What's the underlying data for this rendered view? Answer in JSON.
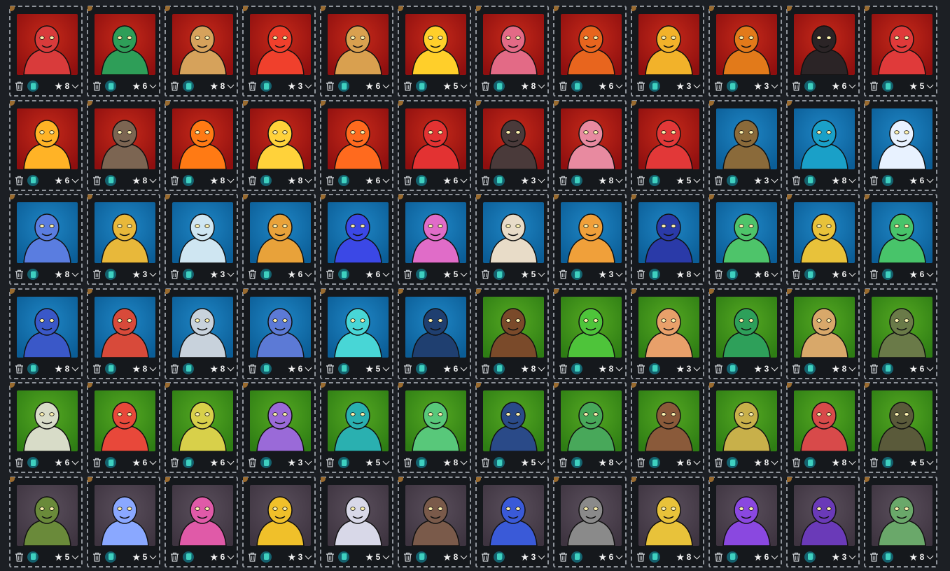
{
  "element_colors": {
    "fire": {
      "bg": "#8e0f0f",
      "glow": "#c72a1a"
    },
    "water": {
      "bg": "#0b5d96",
      "glow": "#1f86c5"
    },
    "earth": {
      "bg": "#2e7d14",
      "glow": "#55a822"
    },
    "death": {
      "bg": "#3e3440",
      "glow": "#5a4f5c"
    }
  },
  "icons": {
    "remove": "trash-icon",
    "deck": "card-deck-icon",
    "level": "star-icon",
    "dropdown": "chevron-down-icon"
  },
  "cards": [
    {
      "element": "fire",
      "accent": "#d93b3b",
      "level": "8"
    },
    {
      "element": "fire",
      "accent": "#2e9e58",
      "level": "6"
    },
    {
      "element": "fire",
      "accent": "#d6a25b",
      "level": "8"
    },
    {
      "element": "fire",
      "accent": "#f0402c",
      "level": "3"
    },
    {
      "element": "fire",
      "accent": "#d9a04f",
      "level": "6"
    },
    {
      "element": "fire",
      "accent": "#ffcf2a",
      "level": "5"
    },
    {
      "element": "fire",
      "accent": "#e36a86",
      "level": "8"
    },
    {
      "element": "fire",
      "accent": "#e8651e",
      "level": "6"
    },
    {
      "element": "fire",
      "accent": "#f2b22a",
      "level": "3"
    },
    {
      "element": "fire",
      "accent": "#e27a1a",
      "level": "3"
    },
    {
      "element": "fire",
      "accent": "#2b2426",
      "level": "6"
    },
    {
      "element": "fire",
      "accent": "#e03a3a",
      "level": "5"
    },
    {
      "element": "fire",
      "accent": "#ffb326",
      "level": "6"
    },
    {
      "element": "fire",
      "accent": "#7c6552",
      "level": "8"
    },
    {
      "element": "fire",
      "accent": "#ff7a14",
      "level": "8"
    },
    {
      "element": "fire",
      "accent": "#ffd23a",
      "level": "8"
    },
    {
      "element": "fire",
      "accent": "#ff6a1e",
      "level": "6"
    },
    {
      "element": "fire",
      "accent": "#e33232",
      "level": "6"
    },
    {
      "element": "fire",
      "accent": "#4a3a3a",
      "level": "3"
    },
    {
      "element": "fire",
      "accent": "#e88aa0",
      "level": "8"
    },
    {
      "element": "fire",
      "accent": "#e23838",
      "level": "5"
    },
    {
      "element": "water",
      "accent": "#8a6a3a",
      "level": "3"
    },
    {
      "element": "water",
      "accent": "#1aa0c8",
      "level": "8"
    },
    {
      "element": "water",
      "accent": "#e8f2ff",
      "level": "6"
    },
    {
      "element": "water",
      "accent": "#5a7de0",
      "level": "8"
    },
    {
      "element": "water",
      "accent": "#e8b83a",
      "level": "3"
    },
    {
      "element": "water",
      "accent": "#cfe6f2",
      "level": "3"
    },
    {
      "element": "water",
      "accent": "#e8a23a",
      "level": "6"
    },
    {
      "element": "water",
      "accent": "#3b48e6",
      "level": "6"
    },
    {
      "element": "water",
      "accent": "#e06cc8",
      "level": "5"
    },
    {
      "element": "water",
      "accent": "#e8dcc8",
      "level": "5"
    },
    {
      "element": "water",
      "accent": "#f0a03a",
      "level": "3"
    },
    {
      "element": "water",
      "accent": "#2a3aa8",
      "level": "8"
    },
    {
      "element": "water",
      "accent": "#4ec46a",
      "level": "6"
    },
    {
      "element": "water",
      "accent": "#e8c23a",
      "level": "6"
    },
    {
      "element": "water",
      "accent": "#48c46a",
      "level": "6"
    },
    {
      "element": "water",
      "accent": "#3a58c8",
      "level": "8"
    },
    {
      "element": "water",
      "accent": "#d84a3a",
      "level": "8"
    },
    {
      "element": "water",
      "accent": "#c8d2dc",
      "level": "8"
    },
    {
      "element": "water",
      "accent": "#5c7ad6",
      "level": "6"
    },
    {
      "element": "water",
      "accent": "#48d6d6",
      "level": "5"
    },
    {
      "element": "water",
      "accent": "#1f3f70",
      "level": "6"
    },
    {
      "element": "earth",
      "accent": "#7a4a2a",
      "level": "8"
    },
    {
      "element": "earth",
      "accent": "#4ec43a",
      "level": "8"
    },
    {
      "element": "earth",
      "accent": "#e8a06a",
      "level": "3"
    },
    {
      "element": "earth",
      "accent": "#2ea05a",
      "level": "3"
    },
    {
      "element": "earth",
      "accent": "#d8a86a",
      "level": "8"
    },
    {
      "element": "earth",
      "accent": "#6a7a48",
      "level": "6"
    },
    {
      "element": "earth",
      "accent": "#d8dcc8",
      "level": "6"
    },
    {
      "element": "earth",
      "accent": "#e8483a",
      "level": "6"
    },
    {
      "element": "earth",
      "accent": "#d8d04a",
      "level": "6"
    },
    {
      "element": "earth",
      "accent": "#9a6ad8",
      "level": "3"
    },
    {
      "element": "earth",
      "accent": "#2ab0b0",
      "level": "5"
    },
    {
      "element": "earth",
      "accent": "#58c87a",
      "level": "8"
    },
    {
      "element": "earth",
      "accent": "#2a4a88",
      "level": "5"
    },
    {
      "element": "earth",
      "accent": "#48a85a",
      "level": "8"
    },
    {
      "element": "earth",
      "accent": "#8a5a3a",
      "level": "6"
    },
    {
      "element": "earth",
      "accent": "#c8b04a",
      "level": "8"
    },
    {
      "element": "earth",
      "accent": "#d84a4a",
      "level": "8"
    },
    {
      "element": "earth",
      "accent": "#5a5a3a",
      "level": "5"
    },
    {
      "element": "death",
      "accent": "#6a8a3a",
      "level": "5"
    },
    {
      "element": "death",
      "accent": "#8aa8ff",
      "level": "5"
    },
    {
      "element": "death",
      "accent": "#e05aa8",
      "level": "6"
    },
    {
      "element": "death",
      "accent": "#f0c02a",
      "level": "3"
    },
    {
      "element": "death",
      "accent": "#d8d8e8",
      "level": "5"
    },
    {
      "element": "death",
      "accent": "#7a5a4a",
      "level": "8"
    },
    {
      "element": "death",
      "accent": "#3a5ad8",
      "level": "3"
    },
    {
      "element": "death",
      "accent": "#8a8a8a",
      "level": "6"
    },
    {
      "element": "death",
      "accent": "#e8c23a",
      "level": "8"
    },
    {
      "element": "death",
      "accent": "#8a48e0",
      "level": "6"
    },
    {
      "element": "death",
      "accent": "#6a3ab8",
      "level": "3"
    },
    {
      "element": "death",
      "accent": "#6aa86a",
      "level": "8"
    }
  ]
}
